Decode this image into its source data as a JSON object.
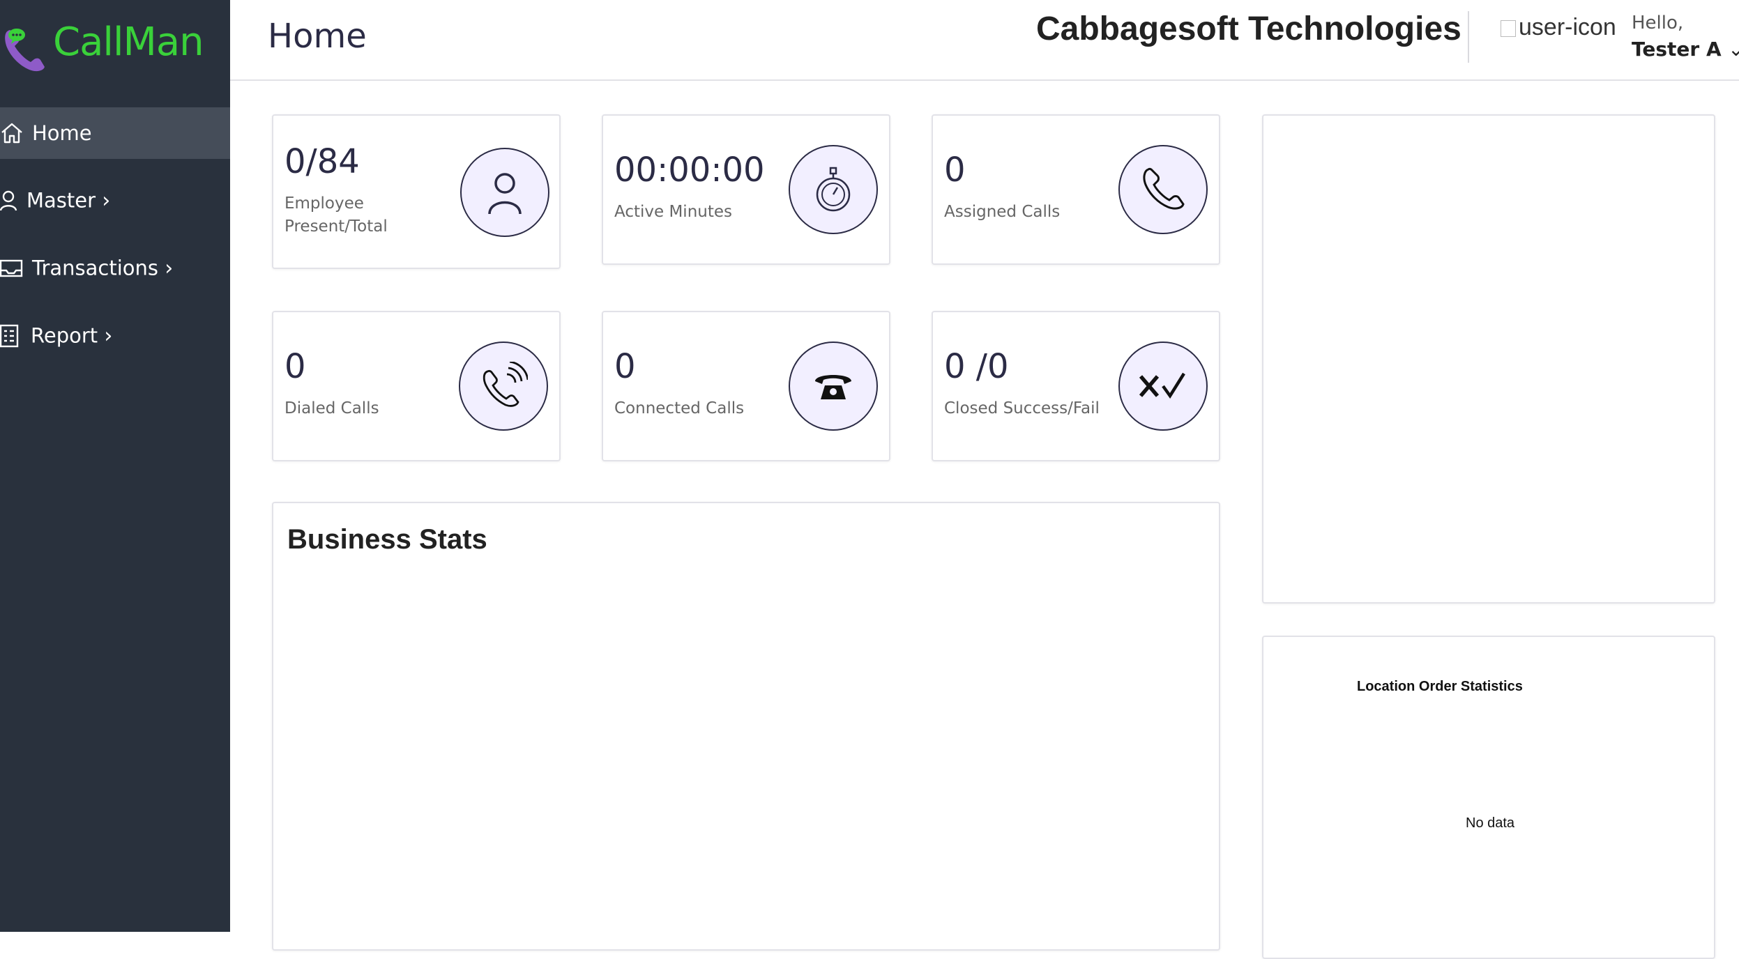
{
  "app": {
    "name": "CallMan"
  },
  "sidebar": {
    "items": [
      {
        "label": "Home",
        "icon": "home-icon",
        "chevron": ""
      },
      {
        "label": "Master",
        "icon": "user-icon",
        "chevron": "›"
      },
      {
        "label": "Transactions",
        "icon": "inbox-icon",
        "chevron": "›"
      },
      {
        "label": "Report",
        "icon": "document-icon",
        "chevron": "›"
      }
    ]
  },
  "header": {
    "title": "Home",
    "company": "Cabbagesoft Technologies",
    "user_image_alt": "user-icon",
    "greeting": "Hello,",
    "username": "Tester A",
    "user_menu_caret": "⌄"
  },
  "stats": [
    {
      "value": "0/84",
      "label": "Employee Present/Total",
      "icon": "person-icon"
    },
    {
      "value": "00:00:00",
      "label": "Active Minutes",
      "icon": "stopwatch-icon"
    },
    {
      "value": "0",
      "label": "Assigned Calls",
      "icon": "phone-icon"
    },
    {
      "value": "0",
      "label": "Dialed Calls",
      "icon": "phone-ringing-icon"
    },
    {
      "value": "0",
      "label": "Connected Calls",
      "icon": "rotary-phone-icon"
    },
    {
      "value": "0 /0",
      "label": "Closed Success/Fail",
      "icon": "cross-check-icon"
    }
  ],
  "business_stats": {
    "title": "Business Stats"
  },
  "location_stats": {
    "title": "Location Order Statistics",
    "empty_text": "No data"
  },
  "colors": {
    "sidebar_bg": "#29313d",
    "sidebar_active": "#454d59",
    "brand_green": "#3ad13a",
    "brand_purple": "#8e5bc8",
    "icon_circle_bg": "#f2efff",
    "text_primary": "#2b2b45"
  }
}
